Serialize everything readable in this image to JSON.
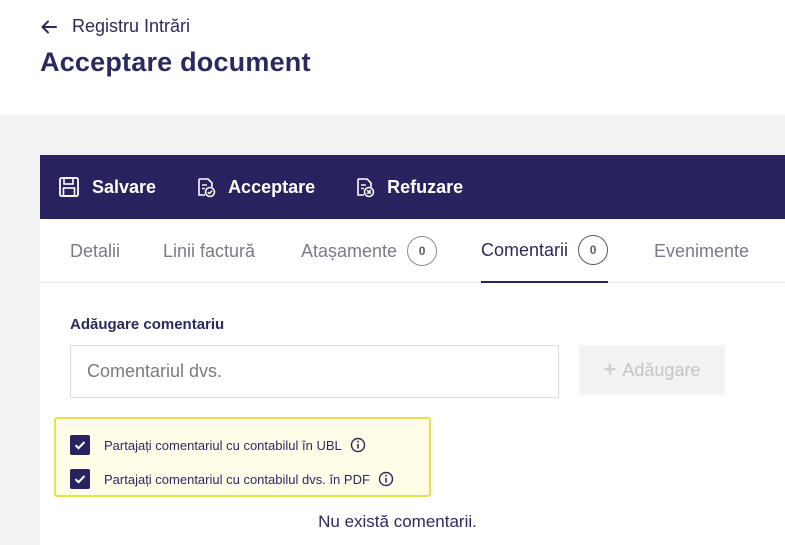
{
  "header": {
    "back_label": "Registru Intrări",
    "title": "Acceptare document"
  },
  "toolbar": {
    "save_label": "Salvare",
    "accept_label": "Acceptare",
    "refuse_label": "Refuzare"
  },
  "tabs": [
    {
      "label": "Detalii"
    },
    {
      "label": "Linii factură"
    },
    {
      "label": "Atașamente",
      "count": "0"
    },
    {
      "label": "Comentarii",
      "count": "0",
      "active": true
    },
    {
      "label": "Evenimente"
    }
  ],
  "comments": {
    "section_label": "Adăugare comentariu",
    "input_value": "",
    "input_placeholder": "Comentariul dvs.",
    "add_label": "Adăugare",
    "share_ubl_label": "Partajați comentariul cu contabilul în UBL",
    "share_pdf_label": "Partajați comentariul cu contabilul dvs. în PDF",
    "empty_message": "Nu există comentarii."
  },
  "colors": {
    "brand": "#28225f",
    "highlight_border": "#e8e24a"
  }
}
